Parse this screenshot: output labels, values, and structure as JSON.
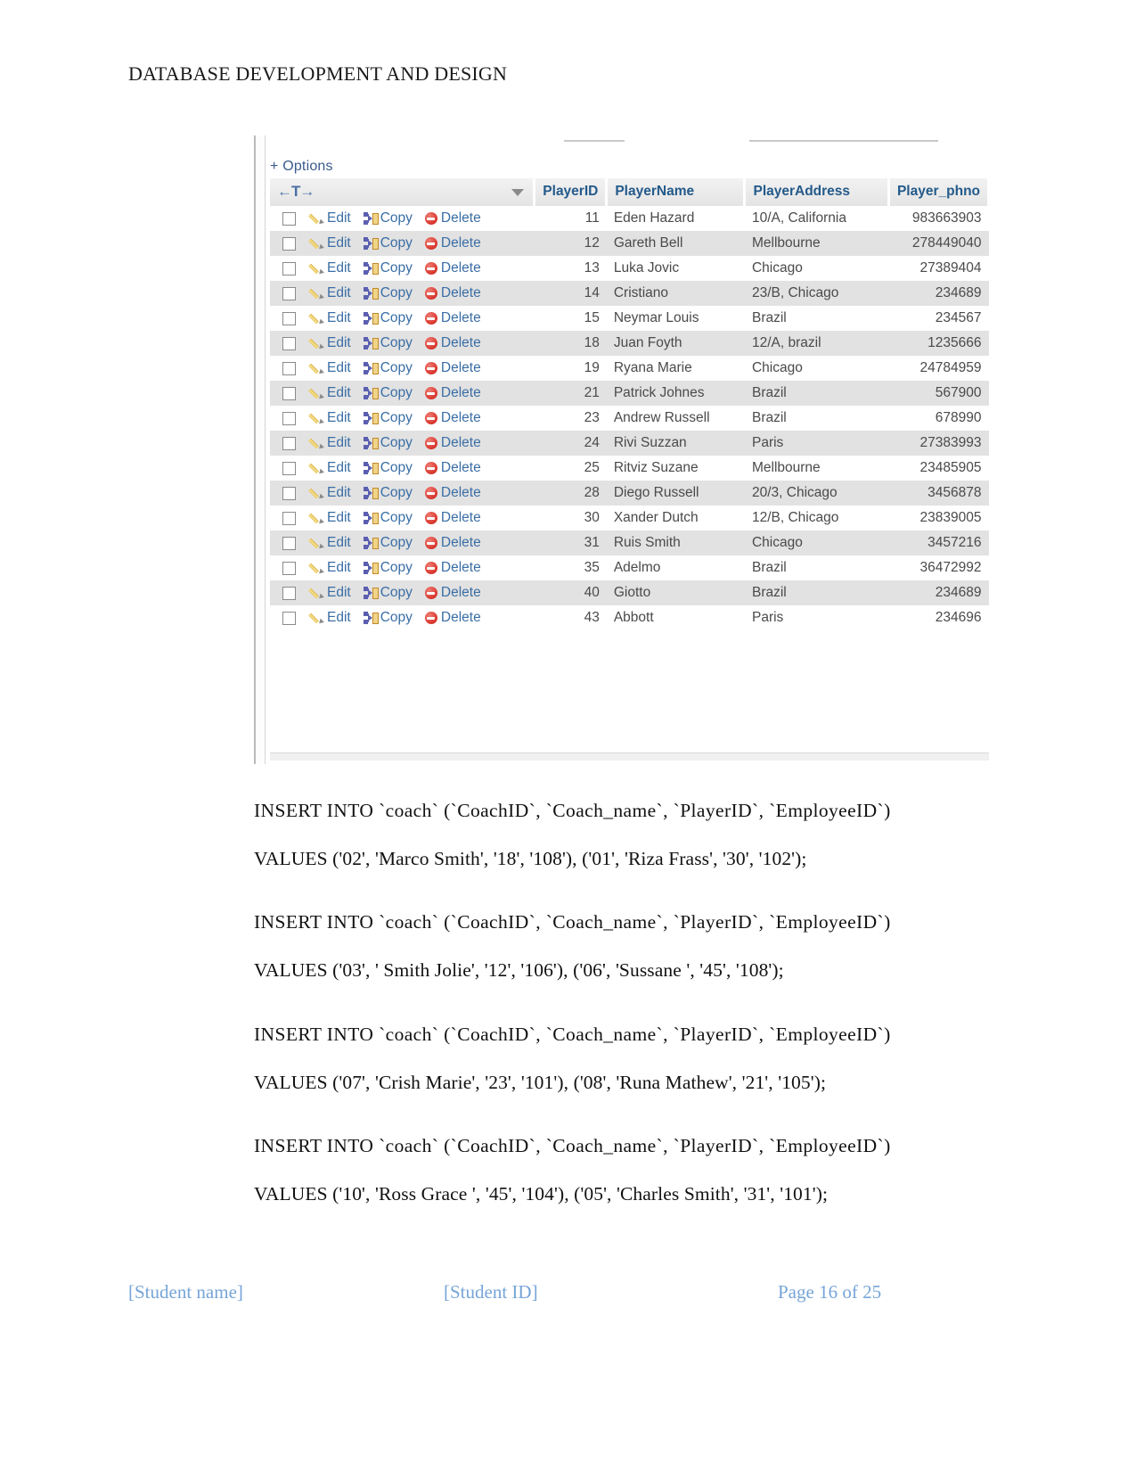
{
  "document": {
    "header_title": "DATABASE DEVELOPMENT AND DESIGN"
  },
  "screenshot": {
    "options_label": "+ Options",
    "sort_control": "←T→",
    "caret_icon": "chevron-down-icon",
    "columns": [
      {
        "key": "actions",
        "label": ""
      },
      {
        "key": "PlayerID",
        "label": "PlayerID"
      },
      {
        "key": "PlayerName",
        "label": "PlayerName"
      },
      {
        "key": "PlayerAddress",
        "label": "PlayerAddress"
      },
      {
        "key": "Player_phno",
        "label": "Player_phno"
      }
    ],
    "row_actions": {
      "edit_label": "Edit",
      "copy_label": "Copy",
      "delete_label": "Delete",
      "edit_icon": "pencil-icon",
      "copy_icon": "copy-icon",
      "delete_icon": "delete-icon",
      "checkbox_icon": "row-checkbox"
    },
    "rows": [
      {
        "id": "11",
        "name": "Eden Hazard",
        "address": "10/A, California",
        "phone": "983663903"
      },
      {
        "id": "12",
        "name": "Gareth Bell",
        "address": "Mellbourne",
        "phone": "278449040"
      },
      {
        "id": "13",
        "name": "Luka  Jovic",
        "address": "Chicago",
        "phone": "27389404"
      },
      {
        "id": "14",
        "name": "Cristiano",
        "address": "23/B, Chicago",
        "phone": "234689"
      },
      {
        "id": "15",
        "name": "Neymar Louis",
        "address": "Brazil",
        "phone": "234567"
      },
      {
        "id": "18",
        "name": "Juan Foyth",
        "address": "12/A, brazil",
        "phone": "1235666"
      },
      {
        "id": "19",
        "name": "Ryana Marie",
        "address": "Chicago",
        "phone": "24784959"
      },
      {
        "id": "21",
        "name": "Patrick Johnes",
        "address": "Brazil",
        "phone": "567900"
      },
      {
        "id": "23",
        "name": "Andrew Russell",
        "address": "Brazil",
        "phone": "678990"
      },
      {
        "id": "24",
        "name": "Rivi Suzzan",
        "address": "Paris",
        "phone": "27383993"
      },
      {
        "id": "25",
        "name": "Ritviz Suzane",
        "address": "Mellbourne",
        "phone": "23485905"
      },
      {
        "id": "28",
        "name": "Diego Russell",
        "address": "20/3, Chicago",
        "phone": "3456878"
      },
      {
        "id": "30",
        "name": "Xander Dutch",
        "address": "12/B, Chicago",
        "phone": "23839005"
      },
      {
        "id": "31",
        "name": "Ruis Smith",
        "address": "Chicago",
        "phone": "3457216"
      },
      {
        "id": "35",
        "name": "Adelmo",
        "address": "Brazil",
        "phone": "36472992"
      },
      {
        "id": "40",
        "name": "Giotto",
        "address": "Brazil",
        "phone": "234689"
      },
      {
        "id": "43",
        "name": "Abbott",
        "address": "Paris",
        "phone": "234696"
      }
    ]
  },
  "sql_statements": [
    {
      "insert": "INSERT  INTO  `coach`  (`CoachID`,  `Coach_name`,  `PlayerID`,  `EmployeeID`)",
      "values": "VALUES ('02', 'Marco Smith', '18', '108'), ('01', 'Riza Frass', '30', '102');"
    },
    {
      "insert": "INSERT  INTO  `coach`  (`CoachID`,  `Coach_name`,  `PlayerID`,  `EmployeeID`)",
      "values": "VALUES ('03', ' Smith Jolie', '12', '106'), ('06', 'Sussane ', '45', '108');"
    },
    {
      "insert": "INSERT  INTO  `coach`  (`CoachID`,  `Coach_name`,  `PlayerID`,  `EmployeeID`)",
      "values": "VALUES ('07', 'Crish Marie', '23', '101'), ('08', 'Runa Mathew', '21', '105');"
    },
    {
      "insert": "INSERT  INTO  `coach`  (`CoachID`,  `Coach_name`,  `PlayerID`,  `EmployeeID`)",
      "values": "VALUES ('10', 'Ross Grace ', '45', '104'), ('05', 'Charles Smith', '31', '101');"
    }
  ],
  "footer": {
    "student_name": "[Student name]",
    "student_id": "[Student ID]",
    "page": "Page 16 of 25"
  },
  "colors": {
    "link_blue": "#3a6ea5",
    "header_blue": "#235a8a",
    "footer_blue": "#76a5d8",
    "row_alt": "#e2e2e2"
  }
}
